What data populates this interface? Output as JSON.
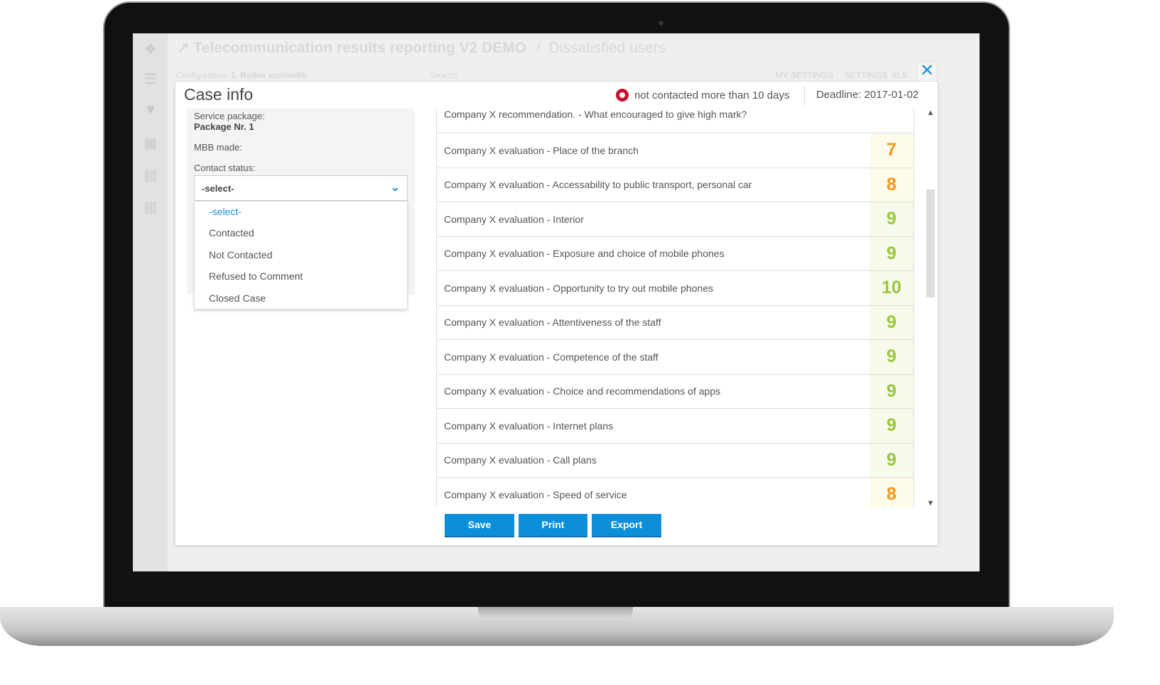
{
  "app": {
    "title": "Telecommunication results reporting V2 DEMO",
    "breadcrumb_page": "Dissatisfied users",
    "configuration_label": "Configuration:",
    "configuration_value": "1. Reikia susisiekti",
    "search_placeholder": "Search",
    "toolbar": [
      "MY SETTINGS",
      "SETTINGS",
      "XLS"
    ]
  },
  "modal": {
    "title": "Case info",
    "status_text": "not contacted more than 10 days",
    "status_color": "#c8102e",
    "deadline": "Deadline: 2017-01-02",
    "left": {
      "service_label": "Service package:",
      "service_value": "Package Nr. 1",
      "mbb_label": "MBB made:",
      "contact_label": "Contact status:",
      "select_value": "-select-",
      "options": [
        "-select-",
        "Contacted",
        "Not Contacted",
        "Refused to Comment",
        "Closed Case"
      ]
    },
    "first_question": "Company X recommendation. - What encouraged to give high mark?",
    "rows": [
      {
        "q": "Company X evaluation - Place of the branch",
        "s": "7",
        "c": "#f7941d",
        "bg": "#fffbea"
      },
      {
        "q": "Company X evaluation - Accessability to public transport, personal car",
        "s": "8",
        "c": "#f7941d",
        "bg": "#fffbea"
      },
      {
        "q": "Company X evaluation - Interior",
        "s": "9",
        "c": "#9bc53d",
        "bg": "#f6fbec"
      },
      {
        "q": "Company X evaluation - Exposure and choice of mobile phones",
        "s": "9",
        "c": "#9bc53d",
        "bg": "#f6fbec"
      },
      {
        "q": "Company X evaluation - Opportunity to try out mobile phones",
        "s": "10",
        "c": "#9bc53d",
        "bg": "#f6fbec"
      },
      {
        "q": "Company X evaluation - Attentiveness of the staff",
        "s": "9",
        "c": "#9bc53d",
        "bg": "#f6fbec"
      },
      {
        "q": "Company X evaluation - Competence of the staff",
        "s": "9",
        "c": "#9bc53d",
        "bg": "#f6fbec"
      },
      {
        "q": "Company X evaluation - Choice and recommendations of apps",
        "s": "9",
        "c": "#9bc53d",
        "bg": "#f6fbec"
      },
      {
        "q": "Company X evaluation - Internet plans",
        "s": "9",
        "c": "#9bc53d",
        "bg": "#f6fbec"
      },
      {
        "q": "Company X evaluation - Call plans",
        "s": "9",
        "c": "#9bc53d",
        "bg": "#f6fbec"
      },
      {
        "q": "Company X evaluation - Speed of service",
        "s": "8",
        "c": "#f7941d",
        "bg": "#fffbea"
      }
    ],
    "buttons": {
      "save": "Save",
      "print": "Print",
      "export": "Export"
    }
  },
  "accent": "#0a8fd8"
}
